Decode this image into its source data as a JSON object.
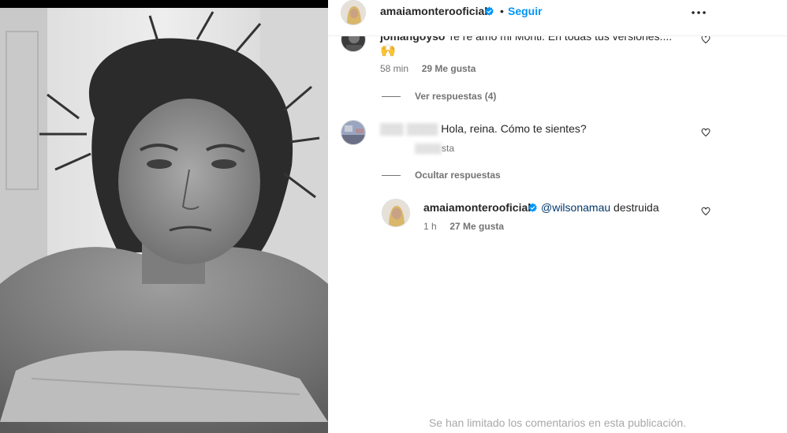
{
  "header": {
    "username": "amaiamonterooficial",
    "separator": "•",
    "follow_label": "Seguir",
    "more_icon": "more-options-icon"
  },
  "comments": [
    {
      "author": "jomangoyso",
      "text": "Te re amo mi Monti. En todas tus versiones....",
      "time": "58 min",
      "likes": "29 Me gusta",
      "replies_label": "Ver respuestas (4)"
    },
    {
      "author_obscured": "▒▒▒  ▒▒▒▒",
      "text": "Hola, reina. Cómo te sientes?",
      "meta_obscured": "▒▒▒▒",
      "meta_tail": "sta",
      "replies_label": "Ocultar respuestas"
    }
  ],
  "reply": {
    "author": "amaiamonterooficial",
    "mention": "@wilsonamau",
    "text": " destruida",
    "time": "1 h",
    "likes": "27 Me gusta"
  },
  "footer": {
    "note": "Se han limitado los comentarios en esta publicación."
  },
  "colors": {
    "link_blue": "#0095f6",
    "mention": "#00376b",
    "meta_gray": "#737373",
    "border": "#dbdbdb"
  }
}
